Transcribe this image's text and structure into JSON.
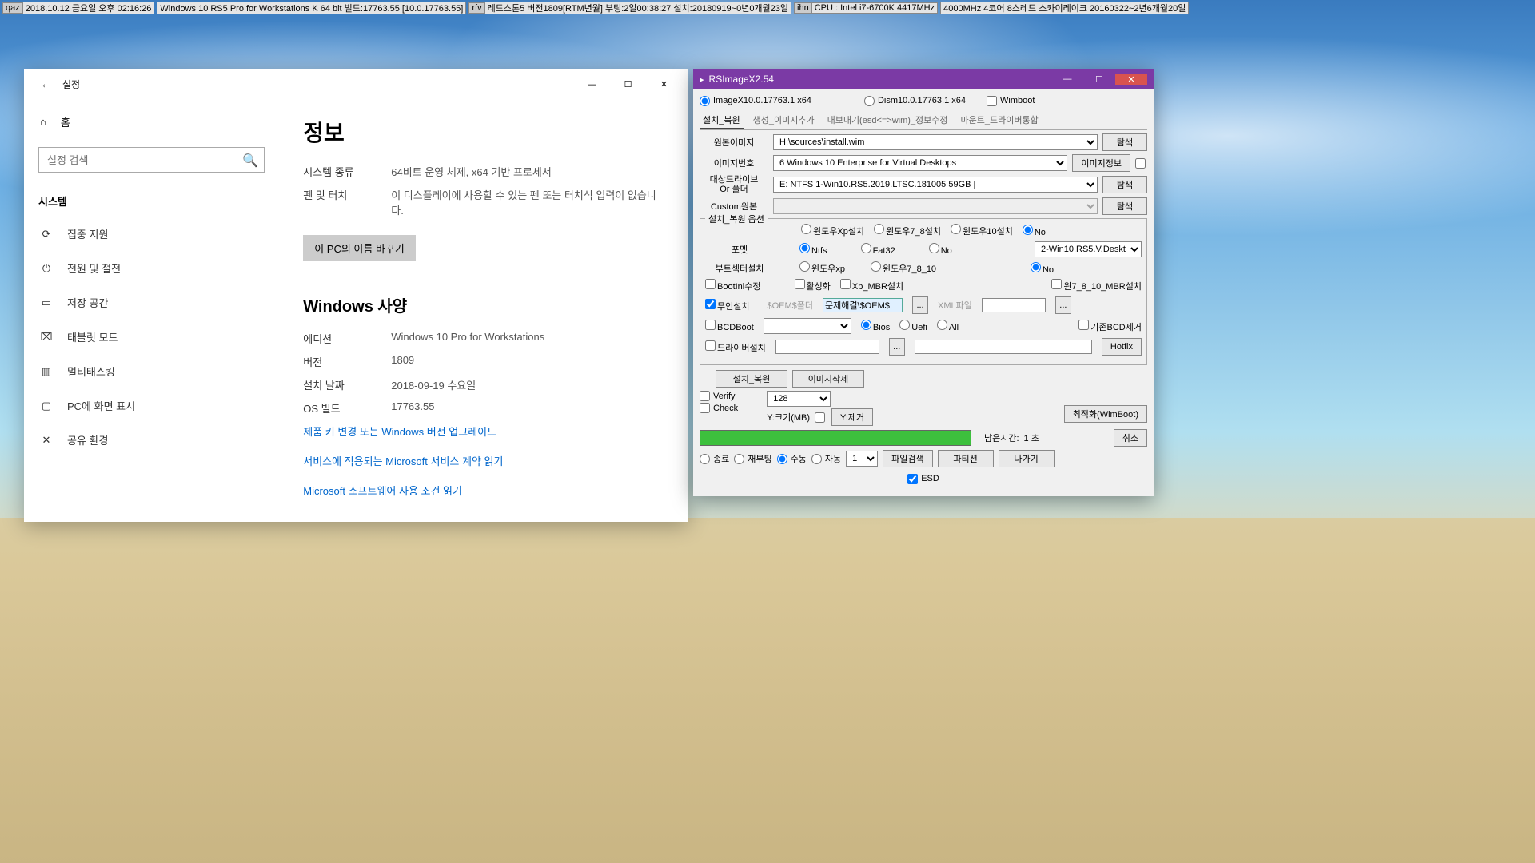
{
  "infobar": [
    {
      "tag": "qaz",
      "text": "2018.10.12 금요일 오후 02:16:26"
    },
    {
      "tag": "",
      "text": "Windows 10 RS5 Pro for Workstations K 64 bit 빌드:17763.55 [10.0.17763.55]"
    },
    {
      "tag": "rfv",
      "text": "레드스톤5 버전1809[RTM년월] 부팅:2일00:38:27 설치:20180919~0년0개월23일"
    },
    {
      "tag": "ihn",
      "text": "CPU : Intel i7-6700K 4417MHz"
    },
    {
      "tag": "",
      "text": "4000MHz 4코어 8스레드 스카이레이크 20160322~2년6개월20일"
    }
  ],
  "settings": {
    "title": "설정",
    "home": "홈",
    "search_placeholder": "설정 검색",
    "section": "시스템",
    "sidebar": [
      {
        "icon": "⟳",
        "label": "집중 지원"
      },
      {
        "icon": "⏻",
        "label": "전원 및 절전"
      },
      {
        "icon": "▭",
        "label": "저장 공간"
      },
      {
        "icon": "⌧",
        "label": "태블릿 모드"
      },
      {
        "icon": "▥",
        "label": "멀티태스킹"
      },
      {
        "icon": "▢",
        "label": "PC에 화면 표시"
      },
      {
        "icon": "✕",
        "label": "공유 환경"
      }
    ],
    "content": {
      "h1": "정보",
      "rows1": [
        {
          "label": "시스템 종류",
          "value": "64비트 운영 체제, x64 기반 프로세서"
        },
        {
          "label": "펜 및 터치",
          "value": "이 디스플레이에 사용할 수 있는 펜 또는 터치식 입력이 없습니다."
        }
      ],
      "rename": "이 PC의 이름 바꾸기",
      "h2": "Windows 사양",
      "rows2": [
        {
          "label": "에디션",
          "value": "Windows 10 Pro for Workstations"
        },
        {
          "label": "버전",
          "value": "1809"
        },
        {
          "label": "설치 날짜",
          "value": "2018-09-19 수요일"
        },
        {
          "label": "OS 빌드",
          "value": "17763.55"
        }
      ],
      "links": [
        "제품 키 변경 또는 Windows 버전 업그레이드",
        "서비스에 적용되는 Microsoft 서비스 계약 읽기",
        "Microsoft 소프트웨어 사용 조건 읽기"
      ]
    }
  },
  "rsimagex": {
    "title": "RSImageX2.54",
    "top_radios": {
      "imagex": "ImageX10.0.17763.1 x64",
      "dism": "Dism10.0.17763.1 x64",
      "wimboot": "Wimboot"
    },
    "tabs": [
      "설치_복원",
      "생성_이미지추가",
      "내보내기(esd<=>wim)_정보수정",
      "마운트_드라이버통합"
    ],
    "fields": {
      "src_image_label": "원본이미지",
      "src_image": "H:\\sources\\install.wim",
      "image_num_label": "이미지번호",
      "image_num": "6  Windows 10 Enterprise for Virtual Desktops",
      "target_label": "대상드라이브\nOr 폴더",
      "target": "E:  NTFS  1-Win10.RS5.2019.LTSC.181005     59GB  |",
      "custom_label": "Custom원본",
      "browse": "탐색",
      "image_info": "이미지정보"
    },
    "group_title": "설치_복원 옵션",
    "win_install": {
      "xp": "윈도우Xp설치",
      "w78": "윈도우7_8설치",
      "w10": "윈도우10설치",
      "no": "No"
    },
    "format": {
      "label": "포멧",
      "ntfs": "Ntfs",
      "fat32": "Fat32",
      "no": "No",
      "combo": "2-Win10.RS5.V.Deskt"
    },
    "bootsector": {
      "label": "부트섹터설치",
      "xp": "윈도우xp",
      "w78": "윈도우7_8_10",
      "no": "No"
    },
    "checks": {
      "bootini": "BootIni수정",
      "activate": "활성화",
      "xpmbr": "Xp_MBR설치",
      "w78mbr": "윈7_8_10_MBR설치"
    },
    "unattend": {
      "label": "무인설치",
      "oem_label": "$OEM$폴더",
      "oem_value": "문제해결\\$OEM$",
      "xml_label": "XML파일"
    },
    "bcd": {
      "label": "BCDBoot",
      "bios": "Bios",
      "uefi": "Uefi",
      "all": "All",
      "delete": "기존BCD제거"
    },
    "driver": {
      "label": "드라이버설치",
      "hotfix": "Hotfix"
    },
    "action_btns": {
      "install": "설치_복원",
      "delete_img": "이미지삭제"
    },
    "verify": {
      "verify": "Verify",
      "check": "Check",
      "combo": "128",
      "ysize": "Y:크기(MB)",
      "yremove": "Y:제거",
      "optimize": "최적화(WimBoot)"
    },
    "progress": {
      "label": "남은시간:",
      "value": "1 초",
      "cancel": "취소"
    },
    "bottom": {
      "shutdown": "종료",
      "reboot": "재부팅",
      "manual": "수동",
      "auto": "자동",
      "combo": "1",
      "search_file": "파일검색",
      "partition": "파티션",
      "exit": "나가기",
      "esd": "ESD"
    }
  }
}
